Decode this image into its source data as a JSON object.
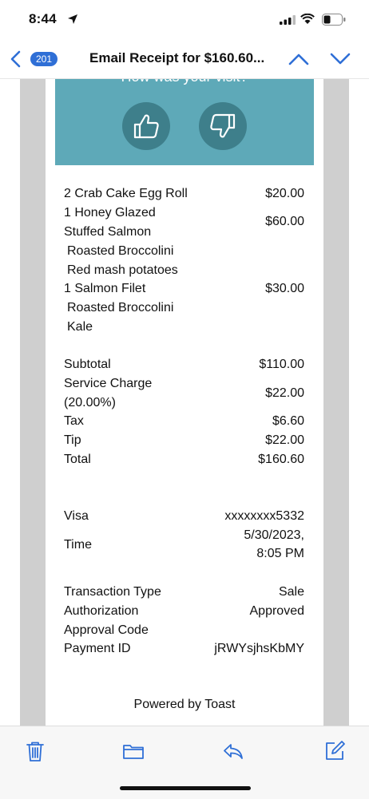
{
  "status_bar": {
    "time": "8:44"
  },
  "nav": {
    "back_count": "201",
    "title": "Email Receipt for $160.60..."
  },
  "feedback": {
    "title": "How was your visit?"
  },
  "items": [
    {
      "name": "2 Crab Cake Egg Roll",
      "price": "$20.00"
    },
    {
      "name_line1": "1 Honey Glazed",
      "name_line2": "Stuffed Salmon",
      "price": "$60.00",
      "modifiers": [
        "Roasted Broccolini",
        "Red mash potatoes"
      ]
    },
    {
      "name": "1 Salmon Filet",
      "price": "$30.00",
      "modifiers": [
        "Roasted Broccolini",
        "Kale"
      ]
    }
  ],
  "totals": {
    "subtotal_label": "Subtotal",
    "subtotal": "$110.00",
    "service_label_line1": "Service Charge",
    "service_label_line2": "(20.00%)",
    "service": "$22.00",
    "tax_label": "Tax",
    "tax": "$6.60",
    "tip_label": "Tip",
    "tip": "$22.00",
    "total_label": "Total",
    "total": "$160.60"
  },
  "payment": {
    "card_label": "Visa",
    "card_number": "xxxxxxxx5332",
    "time_label": "Time",
    "date": "5/30/2023,",
    "time": "8:05 PM",
    "type_label": "Transaction Type",
    "type": "Sale",
    "auth_label": "Authorization",
    "auth": "Approved",
    "approval_label": "Approval Code",
    "payment_id_label": "Payment ID",
    "payment_id": "jRWYsjhsKbMY"
  },
  "footer": {
    "powered_by": "Powered by Toast"
  },
  "colors": {
    "accent": "#2f6fd6",
    "feedback_bg": "#5ea9b8",
    "thumb_bg": "#3e7f8b"
  },
  "toolbar": {
    "icons": [
      "trash-icon",
      "folder-icon",
      "reply-icon",
      "compose-icon"
    ]
  }
}
